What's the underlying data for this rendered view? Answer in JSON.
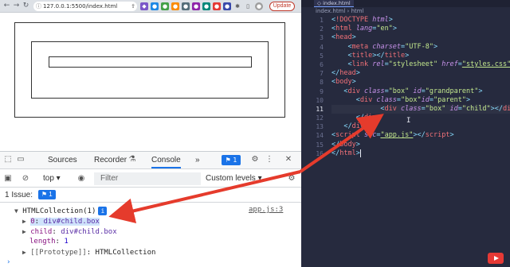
{
  "browser": {
    "url": "127.0.0.1:5500/index.html",
    "update_label": "Update"
  },
  "devtools": {
    "tabs": [
      "Sources",
      "Recorder",
      "Console"
    ],
    "active_tab": "Console",
    "more_tabs": "»",
    "issue_count_badge": "1",
    "context_select": "top ▾",
    "filter_placeholder": "Filter",
    "levels_label": "Custom levels ▾",
    "issues_text": "1 Issue:",
    "issues_badge": "1",
    "console": {
      "collection_label": "HTMLCollection(1)",
      "collection_badge": "i",
      "source_link": "app.js:3",
      "item0_key": "0",
      "item0_value": "div#child.box",
      "child_key": "child",
      "child_value": "div#child.box",
      "length_key": "length",
      "length_value": "1",
      "proto_key": "[[Prototype]]",
      "proto_value": "HTMLCollection"
    }
  },
  "editor": {
    "tab_label": "index.html",
    "breadcrumb": "index.html › html",
    "line_numbers": [
      "1",
      "2",
      "3",
      "4",
      "5",
      "6",
      "7",
      "8",
      "9",
      "10",
      "11",
      "12",
      "13",
      "14",
      "15",
      "16"
    ],
    "current_line": "11"
  },
  "colors": {
    "arrow": "#e53b2c",
    "editor_bg": "#262a3e",
    "selection": "#cfe3fb",
    "accent": "#1a73e8"
  }
}
